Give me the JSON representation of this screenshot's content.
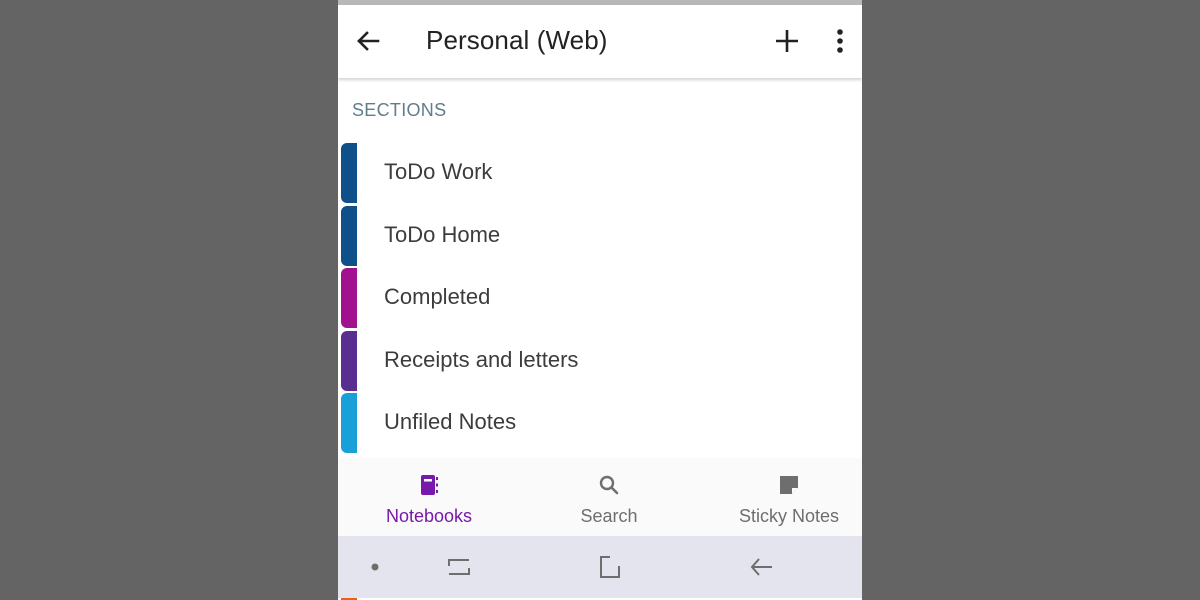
{
  "appbar": {
    "title": "Personal (Web)",
    "back_icon": "arrow-left-icon",
    "add_icon": "plus-icon",
    "more_icon": "more-vertical-icon"
  },
  "sections_header": "SECTIONS",
  "sections": [
    {
      "label": "ToDo Work",
      "color": "#0f4f8a"
    },
    {
      "label": "ToDo Home",
      "color": "#0f4f8a"
    },
    {
      "label": "Completed",
      "color": "#a0108f"
    },
    {
      "label": "Receipts and letters",
      "color": "#5a2d91"
    },
    {
      "label": "Unfiled Notes",
      "color": "#1aa0d8"
    }
  ],
  "bottom_nav": [
    {
      "label": "Notebooks",
      "icon": "notebook-icon",
      "active": true
    },
    {
      "label": "Search",
      "icon": "search-icon",
      "active": false
    },
    {
      "label": "Sticky Notes",
      "icon": "sticky-note-icon",
      "active": false
    }
  ],
  "system_nav": {
    "buttons": [
      "dot-icon",
      "recent-apps-icon",
      "home-icon",
      "back-icon"
    ]
  },
  "colors": {
    "accent": "#7719aa",
    "section_header": "#607d8b",
    "nav_inactive": "#6e6e6e"
  }
}
